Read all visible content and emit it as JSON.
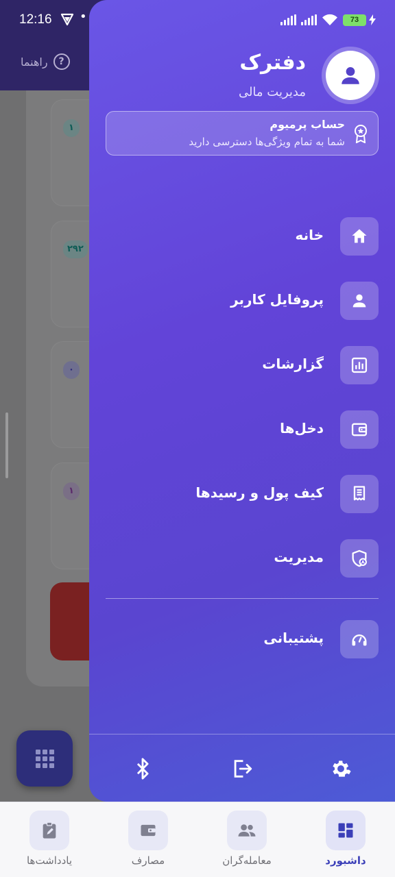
{
  "status_bar": {
    "time": "12:16",
    "battery": "73"
  },
  "background": {
    "help_label": "راهنما",
    "card_chips": [
      "۱",
      "۲۹۲",
      "۰",
      "۱"
    ]
  },
  "drawer": {
    "app_name": "دفترک",
    "app_subtitle": "مدیریت مالی",
    "premium": {
      "title": "حساب پرمیوم",
      "description": "شما به تمام ویژگی‌ها دسترسی دارید"
    },
    "menu": [
      {
        "label": "خانه",
        "icon": "home-icon"
      },
      {
        "label": "پروفایل کاربر",
        "icon": "person-icon"
      },
      {
        "label": "گزارشات",
        "icon": "report-chart-icon"
      },
      {
        "label": "دخل‌ها",
        "icon": "wallet-icon"
      },
      {
        "label": "کیف پول و رسیدها",
        "icon": "receipt-icon"
      },
      {
        "label": "مدیریت",
        "icon": "admin-shield-icon"
      }
    ],
    "support": {
      "label": "پشتیبانی",
      "icon": "support-headset-icon"
    },
    "footer_icons": [
      "settings-icon",
      "logout-icon",
      "bluetooth-icon"
    ]
  },
  "bottom_nav": [
    {
      "label": "داشبورد",
      "icon": "dashboard-icon",
      "active": true
    },
    {
      "label": "معامله‌گران",
      "icon": "people-icon",
      "active": false
    },
    {
      "label": "مصارف",
      "icon": "wallet-icon",
      "active": false
    },
    {
      "label": "یادداشت‌ها",
      "icon": "note-icon",
      "active": false
    }
  ],
  "colors": {
    "drawer_top": "#6a56e6",
    "drawer_bottom": "#4d5bd6",
    "active_nav": "#3b3fb8",
    "battery": "#7ee06a"
  }
}
